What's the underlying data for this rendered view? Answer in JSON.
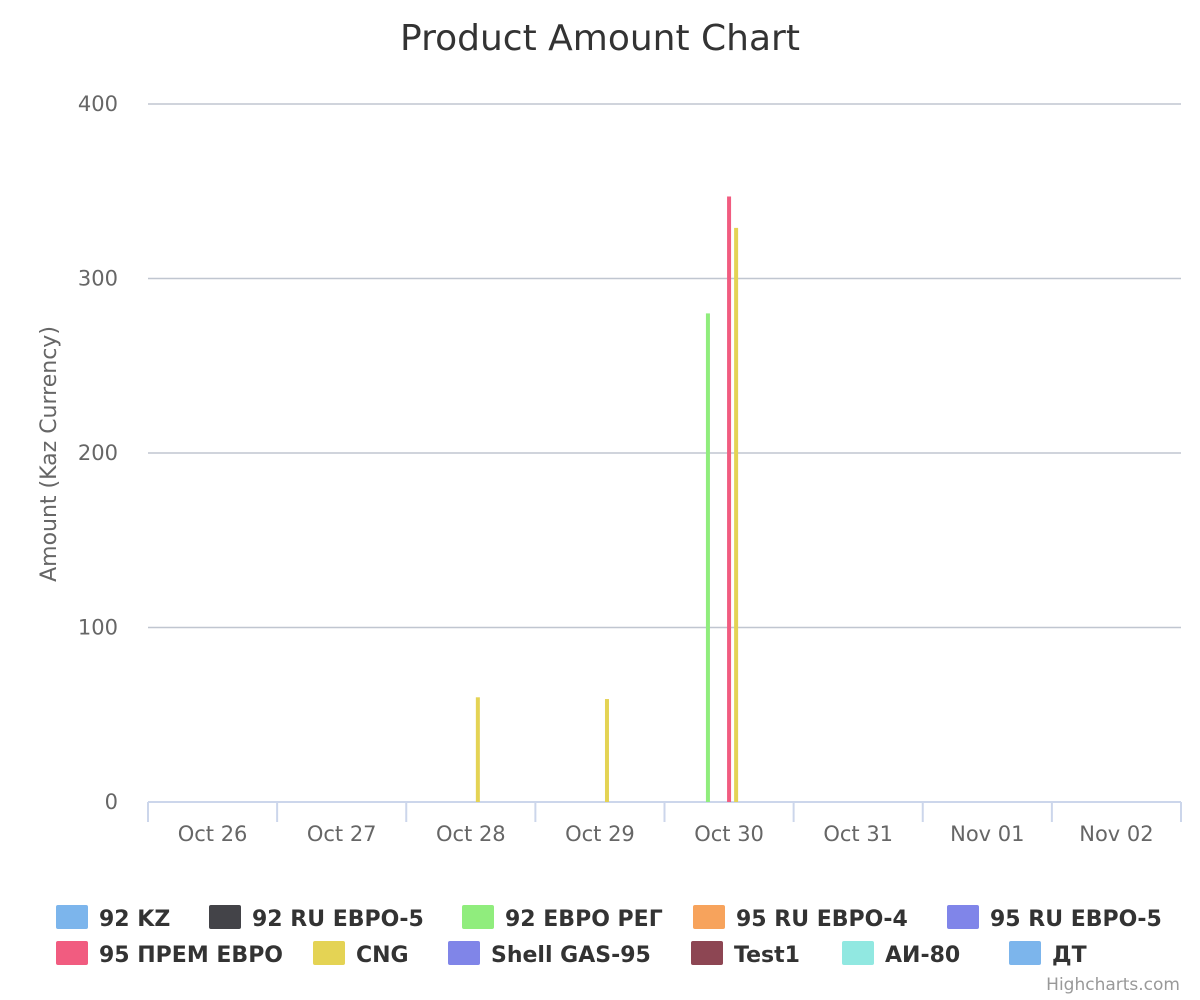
{
  "chart_data": {
    "type": "bar",
    "title": "Product Amount Chart",
    "ylabel": "Amount (Kaz Currency)",
    "xlabel": "",
    "ylim": [
      0,
      400
    ],
    "yticks": [
      0,
      100,
      200,
      300,
      400
    ],
    "grid": true,
    "legend_placement": "bottom",
    "categories": [
      "Oct 26",
      "Oct 27",
      "Oct 28",
      "Oct 29",
      "Oct 30",
      "Oct 31",
      "Nov 01",
      "Nov 02"
    ],
    "series": [
      {
        "name": "92 KZ",
        "color": "#7cb5ec",
        "values": [
          0,
          0,
          0,
          0,
          0,
          0,
          0,
          0
        ]
      },
      {
        "name": "92 RU ЕВРО-5",
        "color": "#434348",
        "values": [
          0,
          0,
          0,
          0,
          0,
          0,
          0,
          0
        ]
      },
      {
        "name": "92 ЕВРО РЕГ",
        "color": "#90ed7d",
        "values": [
          0,
          0,
          0,
          0,
          280,
          0,
          0,
          0
        ]
      },
      {
        "name": "95 RU ЕВРО-4",
        "color": "#f7a35c",
        "values": [
          0,
          0,
          0,
          0,
          0,
          0,
          0,
          0
        ]
      },
      {
        "name": "95 RU ЕВРО-5",
        "color": "#8085e9",
        "values": [
          0,
          0,
          0,
          0,
          0,
          0,
          0,
          0
        ]
      },
      {
        "name": "95 ПРЕМ ЕВРО",
        "color": "#f15c80",
        "values": [
          0,
          0,
          0,
          0,
          347,
          0,
          0,
          0
        ]
      },
      {
        "name": "CNG",
        "color": "#e4d354",
        "values": [
          0,
          0,
          60,
          59,
          329,
          0,
          0,
          0
        ]
      },
      {
        "name": "Shell GAS-95",
        "color": "#8085e8",
        "values": [
          0,
          0,
          0,
          0,
          0,
          0,
          0,
          0
        ]
      },
      {
        "name": "Test1",
        "color": "#8d4653",
        "values": [
          0,
          0,
          0,
          0,
          0,
          0,
          0,
          0
        ]
      },
      {
        "name": "АИ-80",
        "color": "#91e8e1",
        "values": [
          0,
          0,
          0,
          0,
          0,
          0,
          0,
          0
        ]
      },
      {
        "name": "ДТ",
        "color": "#7cb5ec",
        "values": [
          0,
          0,
          0,
          0,
          0,
          0,
          0,
          0
        ]
      }
    ],
    "credits": "Highcharts.com"
  }
}
